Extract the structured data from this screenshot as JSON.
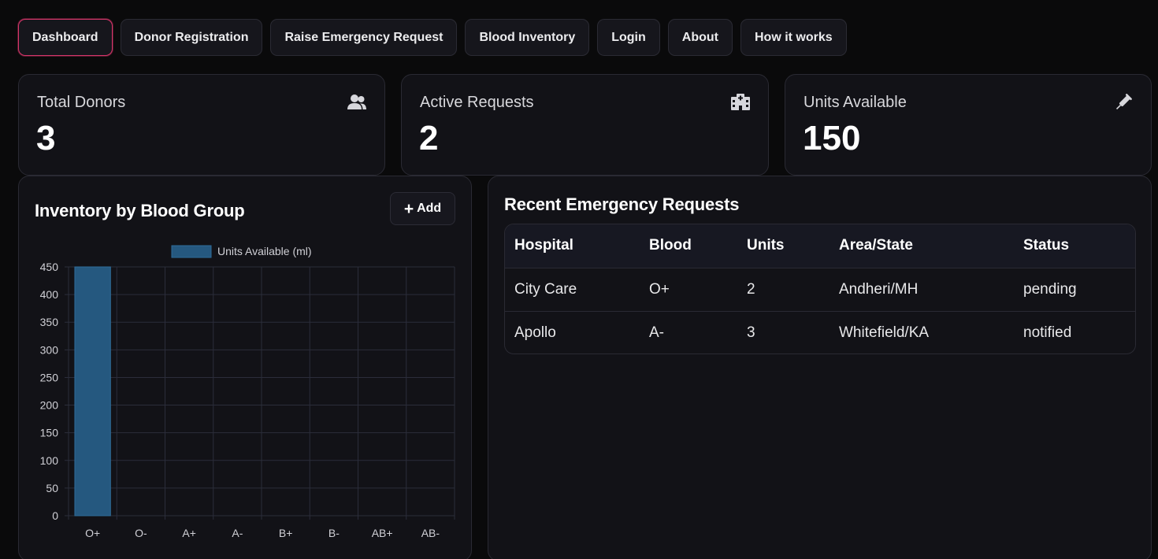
{
  "nav": {
    "items": [
      {
        "label": "Dashboard",
        "active": true
      },
      {
        "label": "Donor Registration"
      },
      {
        "label": "Raise Emergency Request"
      },
      {
        "label": "Blood Inventory"
      },
      {
        "label": "Login"
      },
      {
        "label": "About"
      },
      {
        "label": "How it works"
      }
    ]
  },
  "stats": [
    {
      "label": "Total Donors",
      "value": "3",
      "icon": "users-icon"
    },
    {
      "label": "Active Requests",
      "value": "2",
      "icon": "hospital-icon"
    },
    {
      "label": "Units Available",
      "value": "150",
      "icon": "syringe-icon"
    }
  ],
  "inventory": {
    "title": "Inventory by Blood Group",
    "add_label": "Add"
  },
  "requests": {
    "title": "Recent Emergency Requests",
    "columns": [
      "Hospital",
      "Blood",
      "Units",
      "Area/State",
      "Status"
    ],
    "rows": [
      [
        "City Care",
        "O+",
        "2",
        "Andheri/MH",
        "pending"
      ],
      [
        "Apollo",
        "A-",
        "3",
        "Whitefield/KA",
        "notified"
      ]
    ]
  },
  "chart_data": {
    "type": "bar",
    "categories": [
      "O+",
      "O-",
      "A+",
      "A-",
      "B+",
      "B-",
      "AB+",
      "AB-"
    ],
    "series": [
      {
        "name": "Units Available (ml)",
        "values": [
          450,
          0,
          0,
          0,
          0,
          0,
          0,
          0
        ]
      }
    ],
    "ylim": [
      0,
      450
    ],
    "yticks": [
      0,
      50,
      100,
      150,
      200,
      250,
      300,
      350,
      400,
      450
    ],
    "grid": true,
    "legend": "top",
    "colors": {
      "bar_fill": "#25587f",
      "bar_stroke": "#2f6d9b",
      "grid": "#2b2d3a",
      "tick_text": "#d0d0d6"
    }
  },
  "colors": {
    "background": "#0a0a0b",
    "card": "#121217",
    "accent": "#d6366a"
  }
}
